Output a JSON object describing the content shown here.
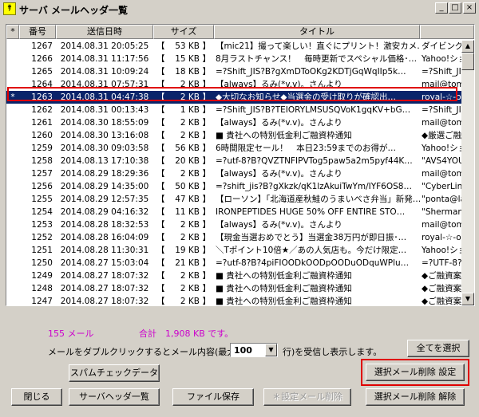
{
  "window": {
    "title": "サーバ メールヘッダ一覧",
    "icon_label": "ｻ"
  },
  "controls": {
    "minimize": "_",
    "maximize": "□",
    "close": "×"
  },
  "columns": [
    "*",
    "番号",
    "送信日時",
    "サイズ",
    "タイトル"
  ],
  "rows": [
    {
      "mark": "",
      "num": "1267",
      "date": "2014.08.31 20:05:25",
      "size": "53 KB",
      "title": "【mic21】撮って楽しい！直ぐにプリント！激安カメ…",
      "from": "ダイビングショップ"
    },
    {
      "mark": "",
      "num": "1266",
      "date": "2014.08.31 11:17:56",
      "size": "15 KB",
      "title": "8月ラストチャンス！　毎時更新でスペシャル価格･…",
      "from": "Yahoo!ショッピ"
    },
    {
      "mark": "",
      "num": "1265",
      "date": "2014.08.31 10:09:24",
      "size": "18 KB",
      "title": "=?Shift_JIS?B?gXmDToOKg2KDTjGqWqIIp5k…",
      "from": "=?Shift_JIS?B?g"
    },
    {
      "mark": "",
      "num": "1264",
      "date": "2014.08.31 07:57:31",
      "size": "2 KB",
      "title": "【always】るみ(*v.v)。さんより",
      "from": "mail@tomag.jp"
    },
    {
      "mark": "*",
      "num": "1263",
      "date": "2014.08.31 04:47:38",
      "size": "2 KB",
      "title": "◆大切なお知らせ◆当選金の受け取りが確認出…",
      "from": "royal-☆-onlin"
    },
    {
      "mark": "",
      "num": "1262",
      "date": "2014.08.31 00:13:43",
      "size": "1 KB",
      "title": "=?Shift_JIS?B?TEIORYLMSUSQVoK1gqKV+bG…",
      "from": "=?Shift_JIS?B?g"
    },
    {
      "mark": "",
      "num": "1261",
      "date": "2014.08.30 18:55:09",
      "size": "2 KB",
      "title": "【always】るみ(*v.v)。さんより",
      "from": "mail@tomag.jp"
    },
    {
      "mark": "",
      "num": "1260",
      "date": "2014.08.30 13:16:08",
      "size": "2 KB",
      "title": "■ 貴社への特別低金利ご融資枠通知",
      "from": "◆厳選ご融資"
    },
    {
      "mark": "",
      "num": "1259",
      "date": "2014.08.30 09:03:58",
      "size": "56 KB",
      "title": "6時間限定セール！　本日23:59までのお得が…",
      "from": "Yahoo!ショッピ"
    },
    {
      "mark": "",
      "num": "1258",
      "date": "2014.08.13 17:10:38",
      "size": "20 KB",
      "title": "=?utf-8?B?QVZTNFIPVTog5paw5a2m5pyf44K…",
      "from": "\"AVS4YOU\" <"
    },
    {
      "mark": "",
      "num": "1257",
      "date": "2014.08.29 18:29:36",
      "size": "2 KB",
      "title": "【always】るみ(*v.v)。さんより",
      "from": "mail@tomag.jp"
    },
    {
      "mark": "",
      "num": "1256",
      "date": "2014.08.29 14:35:00",
      "size": "50 KB",
      "title": "=?shift_jis?B?gXkzk/qK1lzAkuiTwYm/IYF6OS8…",
      "from": "\"CyberLink Co"
    },
    {
      "mark": "",
      "num": "1255",
      "date": "2014.08.29 12:57:35",
      "size": "47 KB",
      "title": "【ローソン】「北海道産秋鮭のうまいべさ弁当」新発…",
      "from": "\"ponta@lawso"
    },
    {
      "mark": "",
      "num": "1254",
      "date": "2014.08.29 04:16:32",
      "size": "11 KB",
      "title": "IRONPEPTIDES HUGE 50% OFF ENTIRE STO…",
      "from": "\"Sherman Oro"
    },
    {
      "mark": "",
      "num": "1253",
      "date": "2014.08.28 18:32:53",
      "size": "2 KB",
      "title": "【always】るみ(*v.v)。さんより",
      "from": "mail@tomag.jp"
    },
    {
      "mark": "",
      "num": "1252",
      "date": "2014.08.28 16:04:09",
      "size": "2 KB",
      "title": "【現金当選おめでとう】当選金38万円が即日振･…",
      "from": "royal-☆-onlin"
    },
    {
      "mark": "",
      "num": "1251",
      "date": "2014.08.28 11:30:31",
      "size": "19 KB",
      "title": "＼Tポイント10倍★／あの人気店も。今だけ限定…",
      "from": "Yahoo!ショッピ"
    },
    {
      "mark": "",
      "num": "1250",
      "date": "2014.08.27 15:03:04",
      "size": "21 KB",
      "title": "=?utf-8?B?4piFIOODkOODpOODuODquWPlu…",
      "from": "=?UTF-8?B?5c"
    },
    {
      "mark": "",
      "num": "1249",
      "date": "2014.08.27 18:07:32",
      "size": "2 KB",
      "title": "■ 貴社への特別低金利ご融資枠通知",
      "from": "◆ご融資案内"
    },
    {
      "mark": "",
      "num": "1248",
      "date": "2014.08.27 18:07:32",
      "size": "2 KB",
      "title": "■ 貴社への特別低金利ご融資枠通知",
      "from": "◆ご融資案内"
    },
    {
      "mark": "",
      "num": "1247",
      "date": "2014.08.27 18:07:32",
      "size": "2 KB",
      "title": "■ 貴社への特別低金利ご融資枠通知",
      "from": "◆ご融資案内"
    },
    {
      "mark": "",
      "num": "1246",
      "date": "2014.08.27 18:07:32",
      "size": "2 KB",
      "title": "■ 貴社への特別低金利ご融資枠通知",
      "from": "◆ご融資案内"
    }
  ],
  "summary": {
    "count": "155 メール",
    "total": "合計　1,908 KB です。"
  },
  "hint": {
    "before": "メールをダブルクリックするとメール内容(最大",
    "after": "行)を受信し表示します。",
    "max_lines": "100"
  },
  "buttons": {
    "select_all": "全てを選択",
    "spam_check": "スパムチェックデータ",
    "delete_selected_set": "選択メール削除 設定",
    "close": "閉じる",
    "server_header_list": "サーバヘッダ一覧",
    "save_file": "ファイル保存",
    "delete_set_mail": "＊設定メール削除",
    "delete_selected_cancel": "選択メール削除 解除"
  }
}
